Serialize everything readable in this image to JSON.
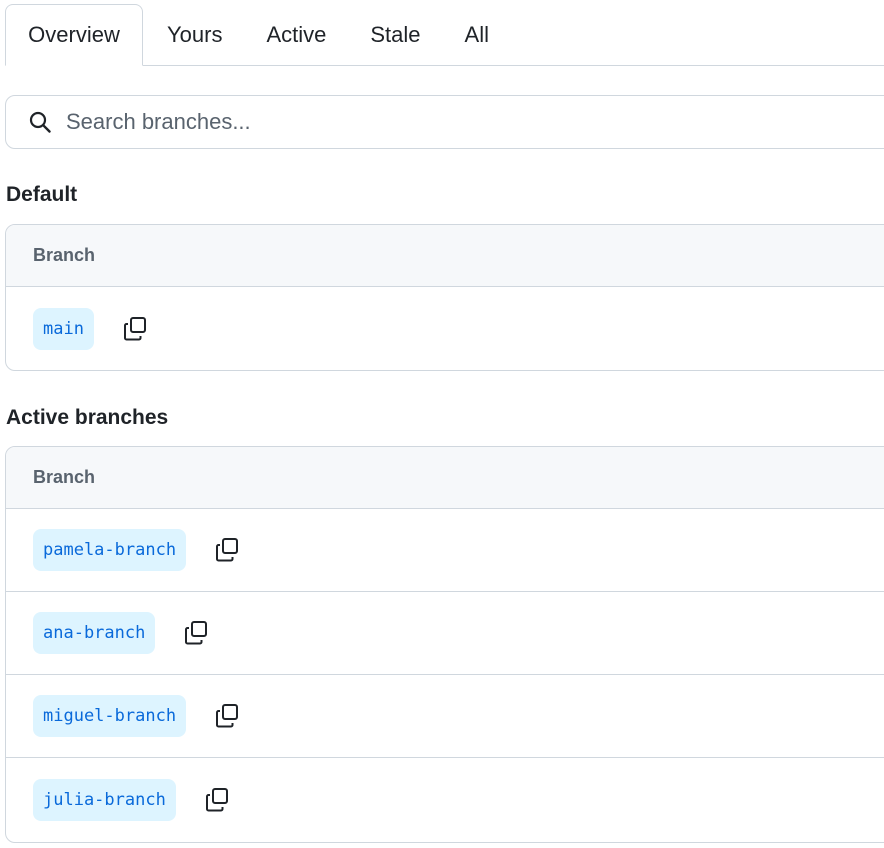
{
  "tabs": [
    {
      "label": "Overview",
      "selected": true
    },
    {
      "label": "Yours",
      "selected": false
    },
    {
      "label": "Active",
      "selected": false
    },
    {
      "label": "Stale",
      "selected": false
    },
    {
      "label": "All",
      "selected": false
    }
  ],
  "search": {
    "placeholder": "Search branches...",
    "icon": "search-icon"
  },
  "sections": {
    "default": {
      "title": "Default",
      "column_header": "Branch",
      "branches": [
        "main"
      ]
    },
    "active": {
      "title": "Active branches",
      "column_header": "Branch",
      "branches": [
        "pamela-branch",
        "ana-branch",
        "miguel-branch",
        "julia-branch"
      ]
    }
  },
  "icons": {
    "copy": "copy-icon"
  },
  "colors": {
    "branch_bg": "#ddf4ff",
    "branch_text": "#0969da",
    "border": "#d0d7de",
    "header_bg": "#f6f8fa"
  }
}
